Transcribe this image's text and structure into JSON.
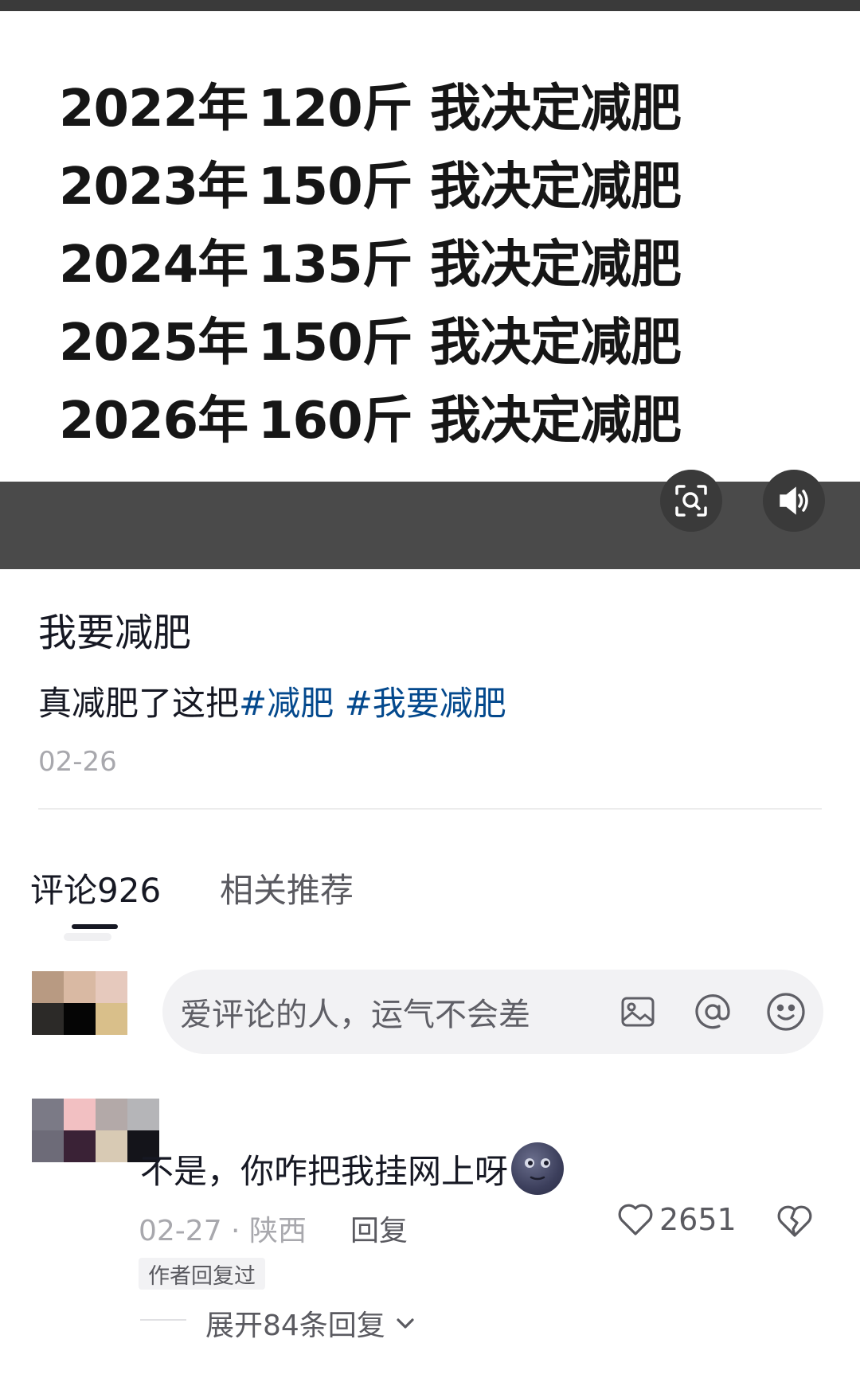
{
  "video": {
    "rows": [
      {
        "year": "2022年",
        "weight": "120斤",
        "phrase": "我决定减肥"
      },
      {
        "year": "2023年",
        "weight": "150斤",
        "phrase": "我决定减肥"
      },
      {
        "year": "2024年",
        "weight": "135斤",
        "phrase": "我决定减肥"
      },
      {
        "year": "2025年",
        "weight": "150斤",
        "phrase": "我决定减肥"
      },
      {
        "year": "2026年",
        "weight": "160斤",
        "phrase": "我决定减肥"
      }
    ],
    "controls": [
      {
        "icon": "scan-search-icon"
      },
      {
        "icon": "volume-icon"
      }
    ]
  },
  "post": {
    "title": "我要减肥",
    "desc_text": "真减肥了这把",
    "hashtags": [
      "#减肥",
      "#我要减肥"
    ],
    "date": "02-26"
  },
  "tabs": {
    "comments": "评论926",
    "related": "相关推荐"
  },
  "comment_input": {
    "placeholder": "爱评论的人，运气不会差",
    "icons": [
      "image-icon",
      "at-icon",
      "emoji-icon"
    ]
  },
  "comment": {
    "text": "不是，你咋把我挂网上呀",
    "emoji": "moon-face-emoji",
    "date_location": "02-27 · 陕西",
    "reply_label": "回复",
    "likes": "2651",
    "author_badge": "作者回复过",
    "expand_label": "展开84条回复"
  },
  "colors": {
    "hashtag": "#04498d",
    "video_bar": "#4a4a4a",
    "muted_text": "#a8a8ad"
  }
}
